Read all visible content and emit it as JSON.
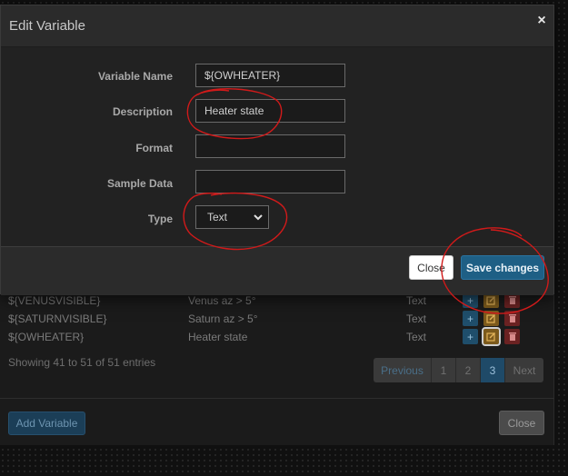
{
  "modal": {
    "title": "Edit Variable",
    "close_icon": "close-icon",
    "fields": {
      "variable_name": {
        "label": "Variable Name",
        "value": "${OWHEATER}"
      },
      "description": {
        "label": "Description",
        "value": "Heater state"
      },
      "format": {
        "label": "Format",
        "value": ""
      },
      "sample_data": {
        "label": "Sample Data",
        "value": ""
      },
      "type": {
        "label": "Type",
        "value": "Text"
      }
    },
    "buttons": {
      "close": "Close",
      "save": "Save changes"
    }
  },
  "table": {
    "rows": [
      {
        "name": "${VENUSVISIBLE}",
        "description": "Venus az > 5°",
        "type": "Text"
      },
      {
        "name": "${SATURNVISIBLE}",
        "description": "Saturn az > 5°",
        "type": "Text"
      },
      {
        "name": "${OWHEATER}",
        "description": "Heater state",
        "type": "Text"
      }
    ],
    "row_icons": {
      "add": "plus-icon",
      "edit": "edit-icon",
      "delete": "trash-icon"
    },
    "showing": "Showing 41 to 51 of 51 entries"
  },
  "pagination": {
    "previous": "Previous",
    "pages": [
      "1",
      "2",
      "3"
    ],
    "active_page": "3",
    "next": "Next"
  },
  "footer": {
    "add_variable": "Add Variable",
    "close": "Close"
  },
  "colors": {
    "primary": "#1e5f85",
    "warning": "#7c5a1c",
    "danger": "#6b2222",
    "annotation": "#d11a1a"
  }
}
